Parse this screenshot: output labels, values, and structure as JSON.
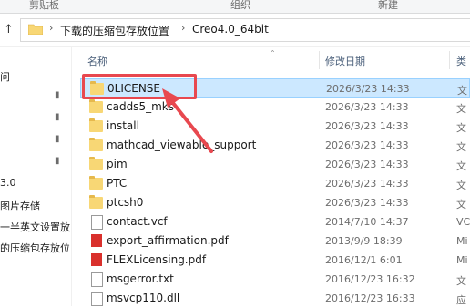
{
  "ribbon": {
    "clipboard": "剪贴板",
    "organize": "组织",
    "new": "新建"
  },
  "address": {
    "crumbs": [
      "下载的压缩包存放位置",
      "Creo4.0_64bit"
    ],
    "separator": "›"
  },
  "nav": {
    "items": [
      "问",
      "3.0",
      "图片存储",
      "一半英文设置放",
      "的压缩包存放位"
    ]
  },
  "columns": {
    "name": "名称",
    "date": "修改日期",
    "type": "类"
  },
  "files": [
    {
      "name": "0LICENSE",
      "date": "2026/3/23 14:33",
      "type": "文",
      "icon": "folder-icon",
      "selected": true
    },
    {
      "name": "cadds5_mks",
      "date": "2026/3/23 14:33",
      "type": "文",
      "icon": "folder-icon"
    },
    {
      "name": "install",
      "date": "2026/3/23 14:33",
      "type": "文",
      "icon": "folder-icon"
    },
    {
      "name": "mathcad_viewable_support",
      "date": "2026/3/23 14:33",
      "type": "文",
      "icon": "folder-icon"
    },
    {
      "name": "pim",
      "date": "2026/3/23 14:33",
      "type": "文",
      "icon": "folder-icon"
    },
    {
      "name": "PTC",
      "date": "2026/3/23 14:33",
      "type": "文",
      "icon": "folder-icon"
    },
    {
      "name": "ptcsh0",
      "date": "2026/3/23 14:33",
      "type": "文",
      "icon": "folder-icon"
    },
    {
      "name": "contact.vcf",
      "date": "2014/7/10 14:37",
      "type": "VC",
      "icon": "document-icon"
    },
    {
      "name": "export_affirmation.pdf",
      "date": "2013/9/9 18:39",
      "type": "Mi",
      "icon": "pdf-icon"
    },
    {
      "name": "FLEXLicensing.pdf",
      "date": "2016/12/1 6:01",
      "type": "Mi",
      "icon": "pdf-icon"
    },
    {
      "name": "msgerror.txt",
      "date": "2016/12/23 16:32",
      "type": "文",
      "icon": "document-icon"
    },
    {
      "name": "msvcp110.dll",
      "date": "2016/12/23 16:33",
      "type": "应",
      "icon": "document-icon"
    }
  ],
  "colors": {
    "selection": "#cce8ff",
    "annotation": "#e8484f",
    "folder": "#f8d775"
  }
}
